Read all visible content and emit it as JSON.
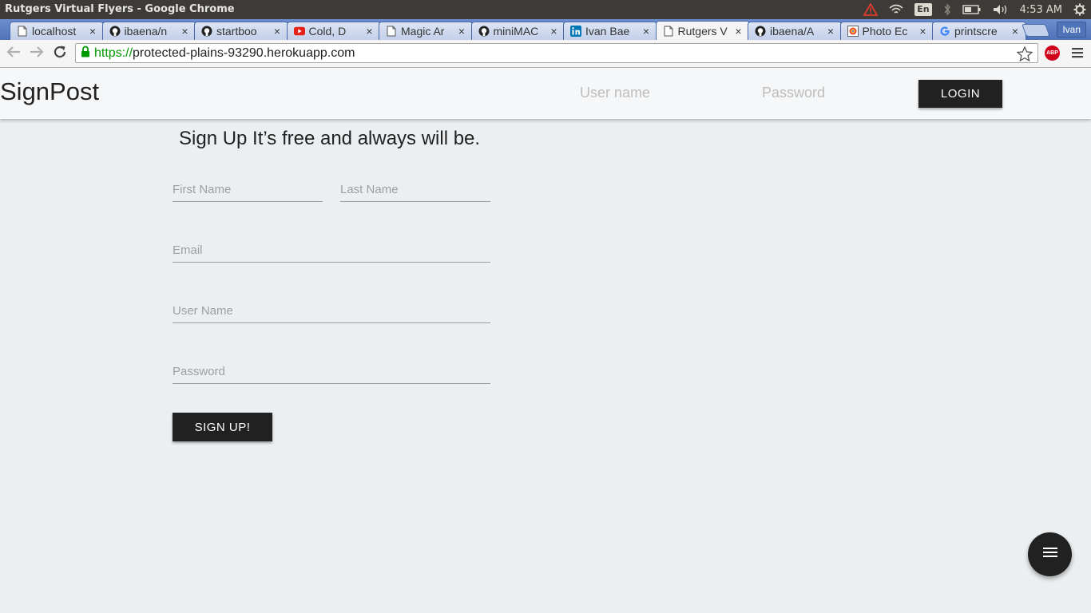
{
  "os": {
    "window_title": "Rutgers Virtual Flyers - Google Chrome",
    "keyboard_lang": "En",
    "clock": "4:53 AM"
  },
  "browser": {
    "tabs": [
      {
        "label": "localhost",
        "icon": "page-icon"
      },
      {
        "label": "ibaena/n",
        "icon": "github-icon"
      },
      {
        "label": "startboo",
        "icon": "github-icon"
      },
      {
        "label": "Cold, D",
        "icon": "youtube-icon"
      },
      {
        "label": "Magic Ar",
        "icon": "page-icon"
      },
      {
        "label": "miniMAC",
        "icon": "github-icon"
      },
      {
        "label": "Ivan Bae",
        "icon": "linkedin-icon"
      },
      {
        "label": "Rutgers V",
        "icon": "page-icon",
        "active": true
      },
      {
        "label": "ibaena/A",
        "icon": "github-icon"
      },
      {
        "label": "Photo Ec",
        "icon": "photo-editor-icon"
      },
      {
        "label": "printscre",
        "icon": "google-icon"
      }
    ],
    "profile_name": "Ivan",
    "url_scheme": "https://",
    "url_host": "protected-plains-93290.herokuapp.com",
    "adblock_label": "ABP"
  },
  "site": {
    "brand": "SignPost",
    "header": {
      "username_placeholder": "User name",
      "password_placeholder": "Password",
      "login_label": "LOGIN"
    },
    "signup": {
      "title": "Sign Up It’s free and always will be.",
      "first_name_placeholder": "First Name",
      "last_name_placeholder": "Last Name",
      "email_placeholder": "Email",
      "username_placeholder": "User Name",
      "password_placeholder": "Password",
      "submit_label": "SIGN UP!"
    }
  }
}
